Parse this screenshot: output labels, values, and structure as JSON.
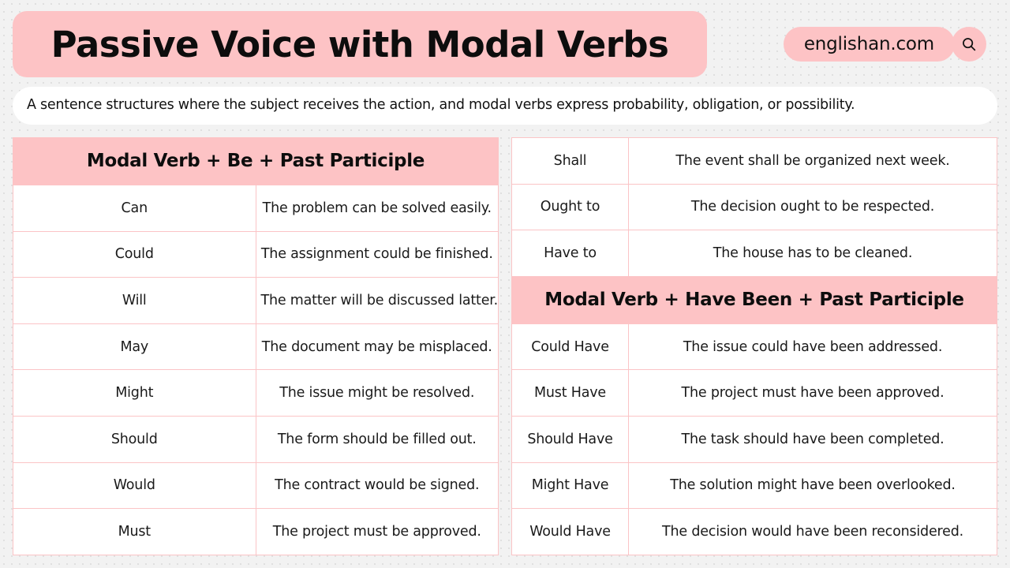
{
  "header": {
    "title": "Passive Voice with Modal Verbs",
    "brand_name": "englishan.com",
    "search_icon": "search-icon"
  },
  "subtitle": "A sentence structures where the subject receives the action, and modal verbs express probability, obligation, or possibility.",
  "colors": {
    "pink": "#fdc3c5",
    "border_pink": "#fbc4c6",
    "page_bg": "#f2f2f2",
    "text": "#1a1a1a",
    "white": "#ffffff"
  },
  "left_table": {
    "band": "Modal Verb + Be + Past Participle",
    "rows": [
      {
        "modal": "Can",
        "example": "The problem can be solved easily."
      },
      {
        "modal": "Could",
        "example": "The assignment could be finished."
      },
      {
        "modal": "Will",
        "example": "The matter will be discussed latter."
      },
      {
        "modal": "May",
        "example": "The document may be misplaced."
      },
      {
        "modal": "Might",
        "example": "The issue might be resolved."
      },
      {
        "modal": "Should",
        "example": "The form should be filled out."
      },
      {
        "modal": "Would",
        "example": "The contract would be signed."
      },
      {
        "modal": "Must",
        "example": "The project must be approved."
      }
    ]
  },
  "right_table_top": {
    "rows": [
      {
        "modal": "Shall",
        "example": "The event shall be organized next week."
      },
      {
        "modal": "Ought to",
        "example": "The decision ought to be respected."
      },
      {
        "modal": "Have to",
        "example": "The house has to be cleaned."
      }
    ]
  },
  "right_table_bottom": {
    "band": "Modal Verb + Have Been + Past Participle",
    "rows": [
      {
        "modal": "Could Have",
        "example": "The issue could have been addressed."
      },
      {
        "modal": "Must Have",
        "example": "The project must have been approved."
      },
      {
        "modal": "Should Have",
        "example": "The task should have been completed."
      },
      {
        "modal": "Might Have",
        "example": "The solution might have been overlooked."
      },
      {
        "modal": "Would Have",
        "example": "The decision would have been reconsidered."
      }
    ]
  }
}
